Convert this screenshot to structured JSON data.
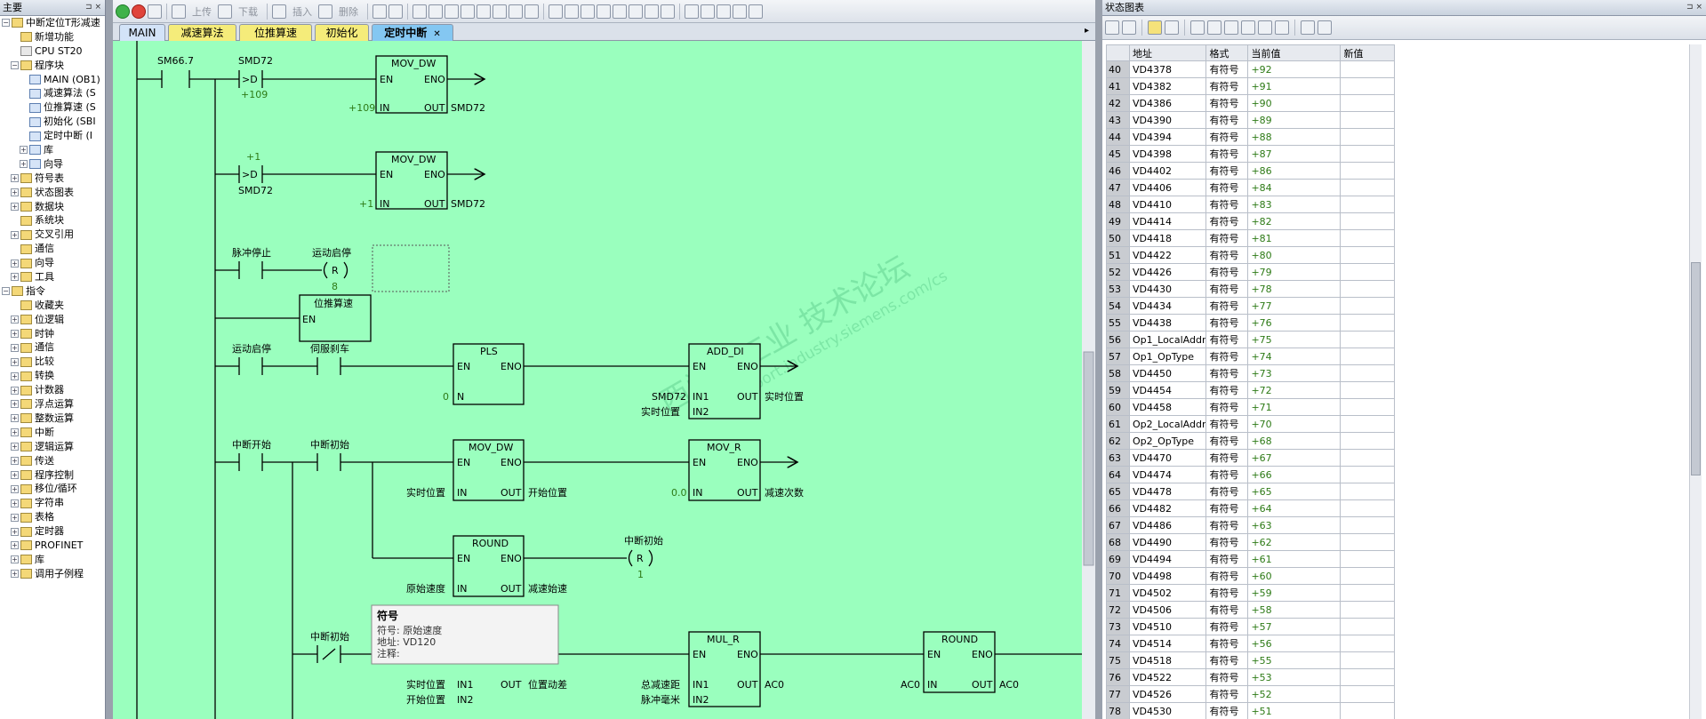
{
  "left_panel": {
    "title": "主要",
    "items": [
      {
        "label": "中断定位T形减速",
        "indent": 0,
        "exp": "-"
      },
      {
        "label": "新增功能",
        "indent": 1,
        "exp": ""
      },
      {
        "label": "CPU ST20",
        "indent": 1,
        "exp": ""
      },
      {
        "label": "程序块",
        "indent": 1,
        "exp": "-"
      },
      {
        "label": "MAIN (OB1)",
        "indent": 2,
        "exp": ""
      },
      {
        "label": "减速算法 (S",
        "indent": 2,
        "exp": ""
      },
      {
        "label": "位推算速 (S",
        "indent": 2,
        "exp": ""
      },
      {
        "label": "初始化 (SBI",
        "indent": 2,
        "exp": ""
      },
      {
        "label": "定时中断 (I",
        "indent": 2,
        "exp": ""
      },
      {
        "label": "库",
        "indent": 2,
        "exp": "+"
      },
      {
        "label": "向导",
        "indent": 2,
        "exp": "+"
      },
      {
        "label": "符号表",
        "indent": 1,
        "exp": "+"
      },
      {
        "label": "状态图表",
        "indent": 1,
        "exp": "+"
      },
      {
        "label": "数据块",
        "indent": 1,
        "exp": "+"
      },
      {
        "label": "系统块",
        "indent": 1,
        "exp": ""
      },
      {
        "label": "交叉引用",
        "indent": 1,
        "exp": "+"
      },
      {
        "label": "通信",
        "indent": 1,
        "exp": ""
      },
      {
        "label": "向导",
        "indent": 1,
        "exp": "+"
      },
      {
        "label": "工具",
        "indent": 1,
        "exp": "+"
      },
      {
        "label": "指令",
        "indent": 0,
        "exp": "-"
      },
      {
        "label": "收藏夹",
        "indent": 1,
        "exp": ""
      },
      {
        "label": "位逻辑",
        "indent": 1,
        "exp": "+"
      },
      {
        "label": "时钟",
        "indent": 1,
        "exp": "+"
      },
      {
        "label": "通信",
        "indent": 1,
        "exp": "+"
      },
      {
        "label": "比较",
        "indent": 1,
        "exp": "+"
      },
      {
        "label": "转换",
        "indent": 1,
        "exp": "+"
      },
      {
        "label": "计数器",
        "indent": 1,
        "exp": "+"
      },
      {
        "label": "浮点运算",
        "indent": 1,
        "exp": "+"
      },
      {
        "label": "整数运算",
        "indent": 1,
        "exp": "+"
      },
      {
        "label": "中断",
        "indent": 1,
        "exp": "+"
      },
      {
        "label": "逻辑运算",
        "indent": 1,
        "exp": "+"
      },
      {
        "label": "传送",
        "indent": 1,
        "exp": "+"
      },
      {
        "label": "程序控制",
        "indent": 1,
        "exp": "+"
      },
      {
        "label": "移位/循环",
        "indent": 1,
        "exp": "+"
      },
      {
        "label": "字符串",
        "indent": 1,
        "exp": "+"
      },
      {
        "label": "表格",
        "indent": 1,
        "exp": "+"
      },
      {
        "label": "定时器",
        "indent": 1,
        "exp": "+"
      },
      {
        "label": "PROFINET",
        "indent": 1,
        "exp": "+"
      },
      {
        "label": "库",
        "indent": 1,
        "exp": "+"
      },
      {
        "label": "调用子例程",
        "indent": 1,
        "exp": "+"
      }
    ]
  },
  "toolbar": {
    "upload": "上传",
    "download": "下载",
    "insert": "插入",
    "delete": "删除"
  },
  "tabs": [
    {
      "label": "MAIN",
      "color": "#d3e3f8"
    },
    {
      "label": "减速算法",
      "color": "#f5ec7a"
    },
    {
      "label": "位推算速",
      "color": "#f5ec7a"
    },
    {
      "label": "初始化",
      "color": "#f5ec7a"
    },
    {
      "label": "定时中断",
      "color": "#84c7f2",
      "active": true
    }
  ],
  "ladder": {
    "sm667": "SM66.7",
    "smd72": "SMD72",
    "cmp": ">D",
    "v109": "+109",
    "v1": "+1",
    "movdw": "MOV_DW",
    "en": "EN",
    "eno": "ENO",
    "in": "IN",
    "out": "OUT",
    "pulse_stop": "脉冲停止",
    "move_start": "运动启停",
    "coil_r": "R",
    "coil8": "8",
    "pos_calc": "位推算速",
    "servo_brake": "伺服刹车",
    "pls": "PLS",
    "zero": "0",
    "add_di": "ADD_DI",
    "in1": "IN1",
    "in2": "IN2",
    "real_pos": "实时位置",
    "int_start": "中断开始",
    "int_init": "中断初始",
    "mov_r": "MOV_R",
    "zero_f": "0.0",
    "start_pos": "开始位置",
    "dec_times": "减速次数",
    "round": "ROUND",
    "orig_speed": "原始速度",
    "dec_start": "减速始速",
    "coil1": "1",
    "neg": "/",
    "mul_r": "MUL_R",
    "pos_change": "位置动差",
    "total_dist": "总减速距",
    "pulse_mm": "脉冲毫米",
    "ac0": "AC0"
  },
  "tooltip": {
    "title": "符号",
    "symbol": "符号: 原始速度",
    "address": "地址: VD120",
    "comment": "注释:"
  },
  "watermark": {
    "line1": "西门子工业  技术论坛",
    "line2": "support.industry.siemens.com/cs"
  },
  "status_chart": {
    "title": "状态图表",
    "headers": [
      "",
      "地址",
      "格式",
      "当前值",
      "新值"
    ],
    "rows": [
      [
        "40",
        "VD4378",
        "有符号",
        "+92"
      ],
      [
        "41",
        "VD4382",
        "有符号",
        "+91"
      ],
      [
        "42",
        "VD4386",
        "有符号",
        "+90"
      ],
      [
        "43",
        "VD4390",
        "有符号",
        "+89"
      ],
      [
        "44",
        "VD4394",
        "有符号",
        "+88"
      ],
      [
        "45",
        "VD4398",
        "有符号",
        "+87"
      ],
      [
        "46",
        "VD4402",
        "有符号",
        "+86"
      ],
      [
        "47",
        "VD4406",
        "有符号",
        "+84"
      ],
      [
        "48",
        "VD4410",
        "有符号",
        "+83"
      ],
      [
        "49",
        "VD4414",
        "有符号",
        "+82"
      ],
      [
        "50",
        "VD4418",
        "有符号",
        "+81"
      ],
      [
        "51",
        "VD4422",
        "有符号",
        "+80"
      ],
      [
        "52",
        "VD4426",
        "有符号",
        "+79"
      ],
      [
        "53",
        "VD4430",
        "有符号",
        "+78"
      ],
      [
        "54",
        "VD4434",
        "有符号",
        "+77"
      ],
      [
        "55",
        "VD4438",
        "有符号",
        "+76"
      ],
      [
        "56",
        "Op1_LocalAddr",
        "有符号",
        "+75"
      ],
      [
        "57",
        "Op1_OpType",
        "有符号",
        "+74"
      ],
      [
        "58",
        "VD4450",
        "有符号",
        "+73"
      ],
      [
        "59",
        "VD4454",
        "有符号",
        "+72"
      ],
      [
        "60",
        "VD4458",
        "有符号",
        "+71"
      ],
      [
        "61",
        "Op2_LocalAddr",
        "有符号",
        "+70"
      ],
      [
        "62",
        "Op2_OpType",
        "有符号",
        "+68"
      ],
      [
        "63",
        "VD4470",
        "有符号",
        "+67"
      ],
      [
        "64",
        "VD4474",
        "有符号",
        "+66"
      ],
      [
        "65",
        "VD4478",
        "有符号",
        "+65"
      ],
      [
        "66",
        "VD4482",
        "有符号",
        "+64"
      ],
      [
        "67",
        "VD4486",
        "有符号",
        "+63"
      ],
      [
        "68",
        "VD4490",
        "有符号",
        "+62"
      ],
      [
        "69",
        "VD4494",
        "有符号",
        "+61"
      ],
      [
        "70",
        "VD4498",
        "有符号",
        "+60"
      ],
      [
        "71",
        "VD4502",
        "有符号",
        "+59"
      ],
      [
        "72",
        "VD4506",
        "有符号",
        "+58"
      ],
      [
        "73",
        "VD4510",
        "有符号",
        "+57"
      ],
      [
        "74",
        "VD4514",
        "有符号",
        "+56"
      ],
      [
        "75",
        "VD4518",
        "有符号",
        "+55"
      ],
      [
        "76",
        "VD4522",
        "有符号",
        "+53"
      ],
      [
        "77",
        "VD4526",
        "有符号",
        "+52"
      ],
      [
        "78",
        "VD4530",
        "有符号",
        "+51"
      ]
    ]
  }
}
